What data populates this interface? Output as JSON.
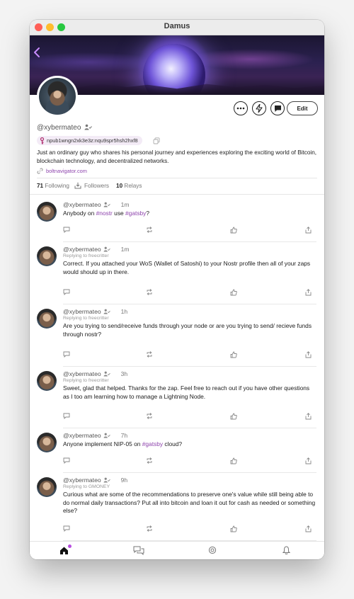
{
  "window": {
    "title": "Damus"
  },
  "profile": {
    "handle": "@xybermateo",
    "npub": "npub1wngn2xk3e3z:nqu9spr5hsh2hxf8",
    "bio": "Just an ordinary guy who shares his personal journey and experiences exploring the exciting world of Bitcoin, blockchain technology, and decentralized networks.",
    "website": "boltnavigator.com",
    "following_count": "71",
    "following_label": "Following",
    "followers_label": "Followers",
    "relays_count": "10",
    "relays_label": "Relays",
    "edit_label": "Edit"
  },
  "posts": [
    {
      "author": "@xybermateo",
      "time": "1m",
      "reply": "",
      "segments": [
        {
          "t": "Anybody on "
        },
        {
          "t": "#nostr",
          "tag": true
        },
        {
          "t": " use "
        },
        {
          "t": "#gatsby",
          "tag": true
        },
        {
          "t": "?"
        }
      ]
    },
    {
      "author": "@xybermateo",
      "time": "1m",
      "reply": "Replying to freecritter",
      "segments": [
        {
          "t": "Correct. If you attached your WoS (Wallet of Satoshi) to your Nostr profile then all of your zaps would should up in there."
        }
      ]
    },
    {
      "author": "@xybermateo",
      "time": "1h",
      "reply": "Replying to freecritter",
      "segments": [
        {
          "t": "Are you trying to send/receive funds through your node or are you trying to send/ recieve funds through nostr?"
        }
      ]
    },
    {
      "author": "@xybermateo",
      "time": "3h",
      "reply": "Replying to freecritter",
      "segments": [
        {
          "t": "Sweet, glad that helped. Thanks for the zap. Feel free to reach out if you have other questions as I too am learning how to manage a Lightning Node."
        }
      ]
    },
    {
      "author": "@xybermateo",
      "time": "7h",
      "reply": "",
      "segments": [
        {
          "t": "Anyone implement NIP-05 on "
        },
        {
          "t": "#gatsby",
          "tag": true
        },
        {
          "t": " cloud?"
        }
      ]
    },
    {
      "author": "@xybermateo",
      "time": "9h",
      "reply": "Replying to GMONEY",
      "segments": [
        {
          "t": "Curious what are some of the recommendations to preserve one's value while still being able to do normal daily transactions? Put all into bitcoin and loan it out for cash as needed or something else?"
        }
      ]
    }
  ],
  "icons": {
    "back": "chevron-left-icon",
    "more": "ellipsis-icon",
    "zap": "lightning-icon",
    "message": "message-icon",
    "key": "key-icon",
    "copy": "copy-icon",
    "link": "link-icon",
    "tabs": [
      "home-icon",
      "chat-bubbles-icon",
      "search-icon",
      "bell-icon"
    ],
    "post_actions": [
      "reply-icon",
      "repost-icon",
      "like-icon",
      "share-icon"
    ]
  },
  "colors": {
    "accent": "#8e44ad",
    "notification_dot": "#b84de0"
  }
}
